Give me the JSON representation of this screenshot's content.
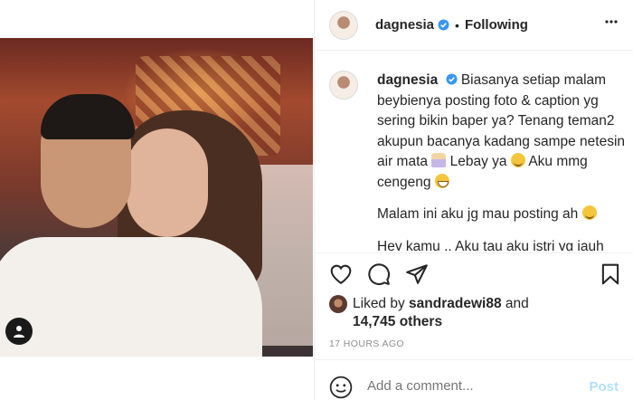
{
  "post": {
    "username": "dagnesia",
    "follow_status": "Following",
    "dot": "•"
  },
  "caption": {
    "username": "dagnesia",
    "line1": "Biasanya setiap malam beybienya posting foto & caption yg sering bikin baper ya? Tenang teman2 akupun bacanya kadang sampe netesin air mata",
    "line1b": "Lebay ya",
    "line1c": "Aku mmg cengeng",
    "line2": "Malam ini aku jg mau posting ah",
    "line3": "Hey kamu .. Aku tau aku istri yg jauh"
  },
  "likes": {
    "prefix": "Liked by",
    "user": "sandradewi88",
    "and": "and",
    "others": "14,745 others"
  },
  "timestamp": "17 HOURS AGO",
  "comment": {
    "placeholder": "Add a comment...",
    "post_label": "Post"
  },
  "icons": {
    "verified": "verified-badge-icon",
    "more": "more-options-icon",
    "like": "heart-icon",
    "comment": "comment-icon",
    "share": "paper-plane-icon",
    "save": "bookmark-icon",
    "emoji": "emoji-icon",
    "tag": "user-tag-icon"
  },
  "colors": {
    "verified": "#3897f0",
    "text": "#262626",
    "muted": "#8e8e8e",
    "post_disabled": "#b2dffc"
  }
}
